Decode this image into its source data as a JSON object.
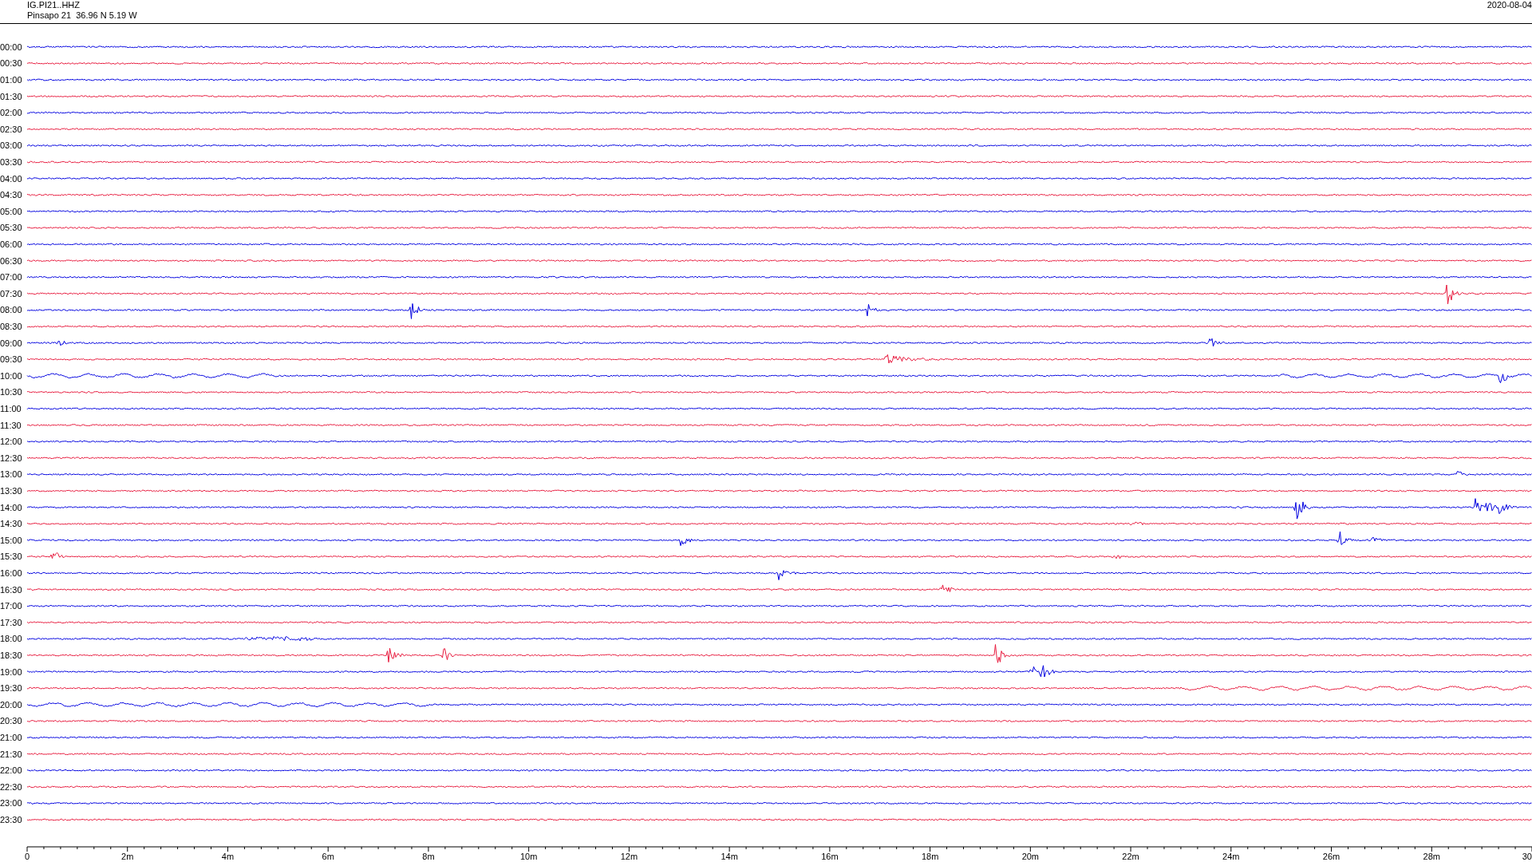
{
  "header": {
    "station": "IG.PI21..HHZ",
    "location": "Pinsapo 21  36.96 N 5.19 W",
    "date": "2020-08-04"
  },
  "rows": [
    {
      "label": "00:00",
      "color": "#0000e0"
    },
    {
      "label": "00:30",
      "color": "#e8183c"
    },
    {
      "label": "01:00",
      "color": "#0000e0"
    },
    {
      "label": "01:30",
      "color": "#e8183c"
    },
    {
      "label": "02:00",
      "color": "#0000e0"
    },
    {
      "label": "02:30",
      "color": "#e8183c"
    },
    {
      "label": "03:00",
      "color": "#0000e0"
    },
    {
      "label": "03:30",
      "color": "#e8183c"
    },
    {
      "label": "04:00",
      "color": "#0000e0"
    },
    {
      "label": "04:30",
      "color": "#e8183c"
    },
    {
      "label": "05:00",
      "color": "#0000e0"
    },
    {
      "label": "05:30",
      "color": "#e8183c"
    },
    {
      "label": "06:00",
      "color": "#0000e0"
    },
    {
      "label": "06:30",
      "color": "#e8183c"
    },
    {
      "label": "07:00",
      "color": "#0000e0"
    },
    {
      "label": "07:30",
      "color": "#e8183c"
    },
    {
      "label": "08:00",
      "color": "#0000e0"
    },
    {
      "label": "08:30",
      "color": "#e8183c"
    },
    {
      "label": "09:00",
      "color": "#0000e0"
    },
    {
      "label": "09:30",
      "color": "#e8183c"
    },
    {
      "label": "10:00",
      "color": "#0000e0"
    },
    {
      "label": "10:30",
      "color": "#e8183c"
    },
    {
      "label": "11:00",
      "color": "#0000e0"
    },
    {
      "label": "11:30",
      "color": "#e8183c"
    },
    {
      "label": "12:00",
      "color": "#0000e0"
    },
    {
      "label": "12:30",
      "color": "#e8183c"
    },
    {
      "label": "13:00",
      "color": "#0000e0"
    },
    {
      "label": "13:30",
      "color": "#e8183c"
    },
    {
      "label": "14:00",
      "color": "#0000e0"
    },
    {
      "label": "14:30",
      "color": "#e8183c"
    },
    {
      "label": "15:00",
      "color": "#0000e0"
    },
    {
      "label": "15:30",
      "color": "#e8183c"
    },
    {
      "label": "16:00",
      "color": "#0000e0"
    },
    {
      "label": "16:30",
      "color": "#e8183c"
    },
    {
      "label": "17:00",
      "color": "#0000e0"
    },
    {
      "label": "17:30",
      "color": "#e8183c"
    },
    {
      "label": "18:00",
      "color": "#0000e0"
    },
    {
      "label": "18:30",
      "color": "#e8183c"
    },
    {
      "label": "19:00",
      "color": "#0000e0"
    },
    {
      "label": "19:30",
      "color": "#e8183c"
    },
    {
      "label": "20:00",
      "color": "#0000e0"
    },
    {
      "label": "20:30",
      "color": "#e8183c"
    },
    {
      "label": "21:00",
      "color": "#0000e0"
    },
    {
      "label": "21:30",
      "color": "#e8183c"
    },
    {
      "label": "22:00",
      "color": "#0000e0"
    },
    {
      "label": "22:30",
      "color": "#e8183c"
    },
    {
      "label": "23:00",
      "color": "#0000e0"
    },
    {
      "label": "23:30",
      "color": "#e8183c"
    }
  ],
  "x_axis": {
    "ticks": [
      "0",
      "2m",
      "4m",
      "6m",
      "8m",
      "10m",
      "12m",
      "14m",
      "16m",
      "18m",
      "20m",
      "22m",
      "24m",
      "26m",
      "28m",
      "30"
    ]
  }
}
